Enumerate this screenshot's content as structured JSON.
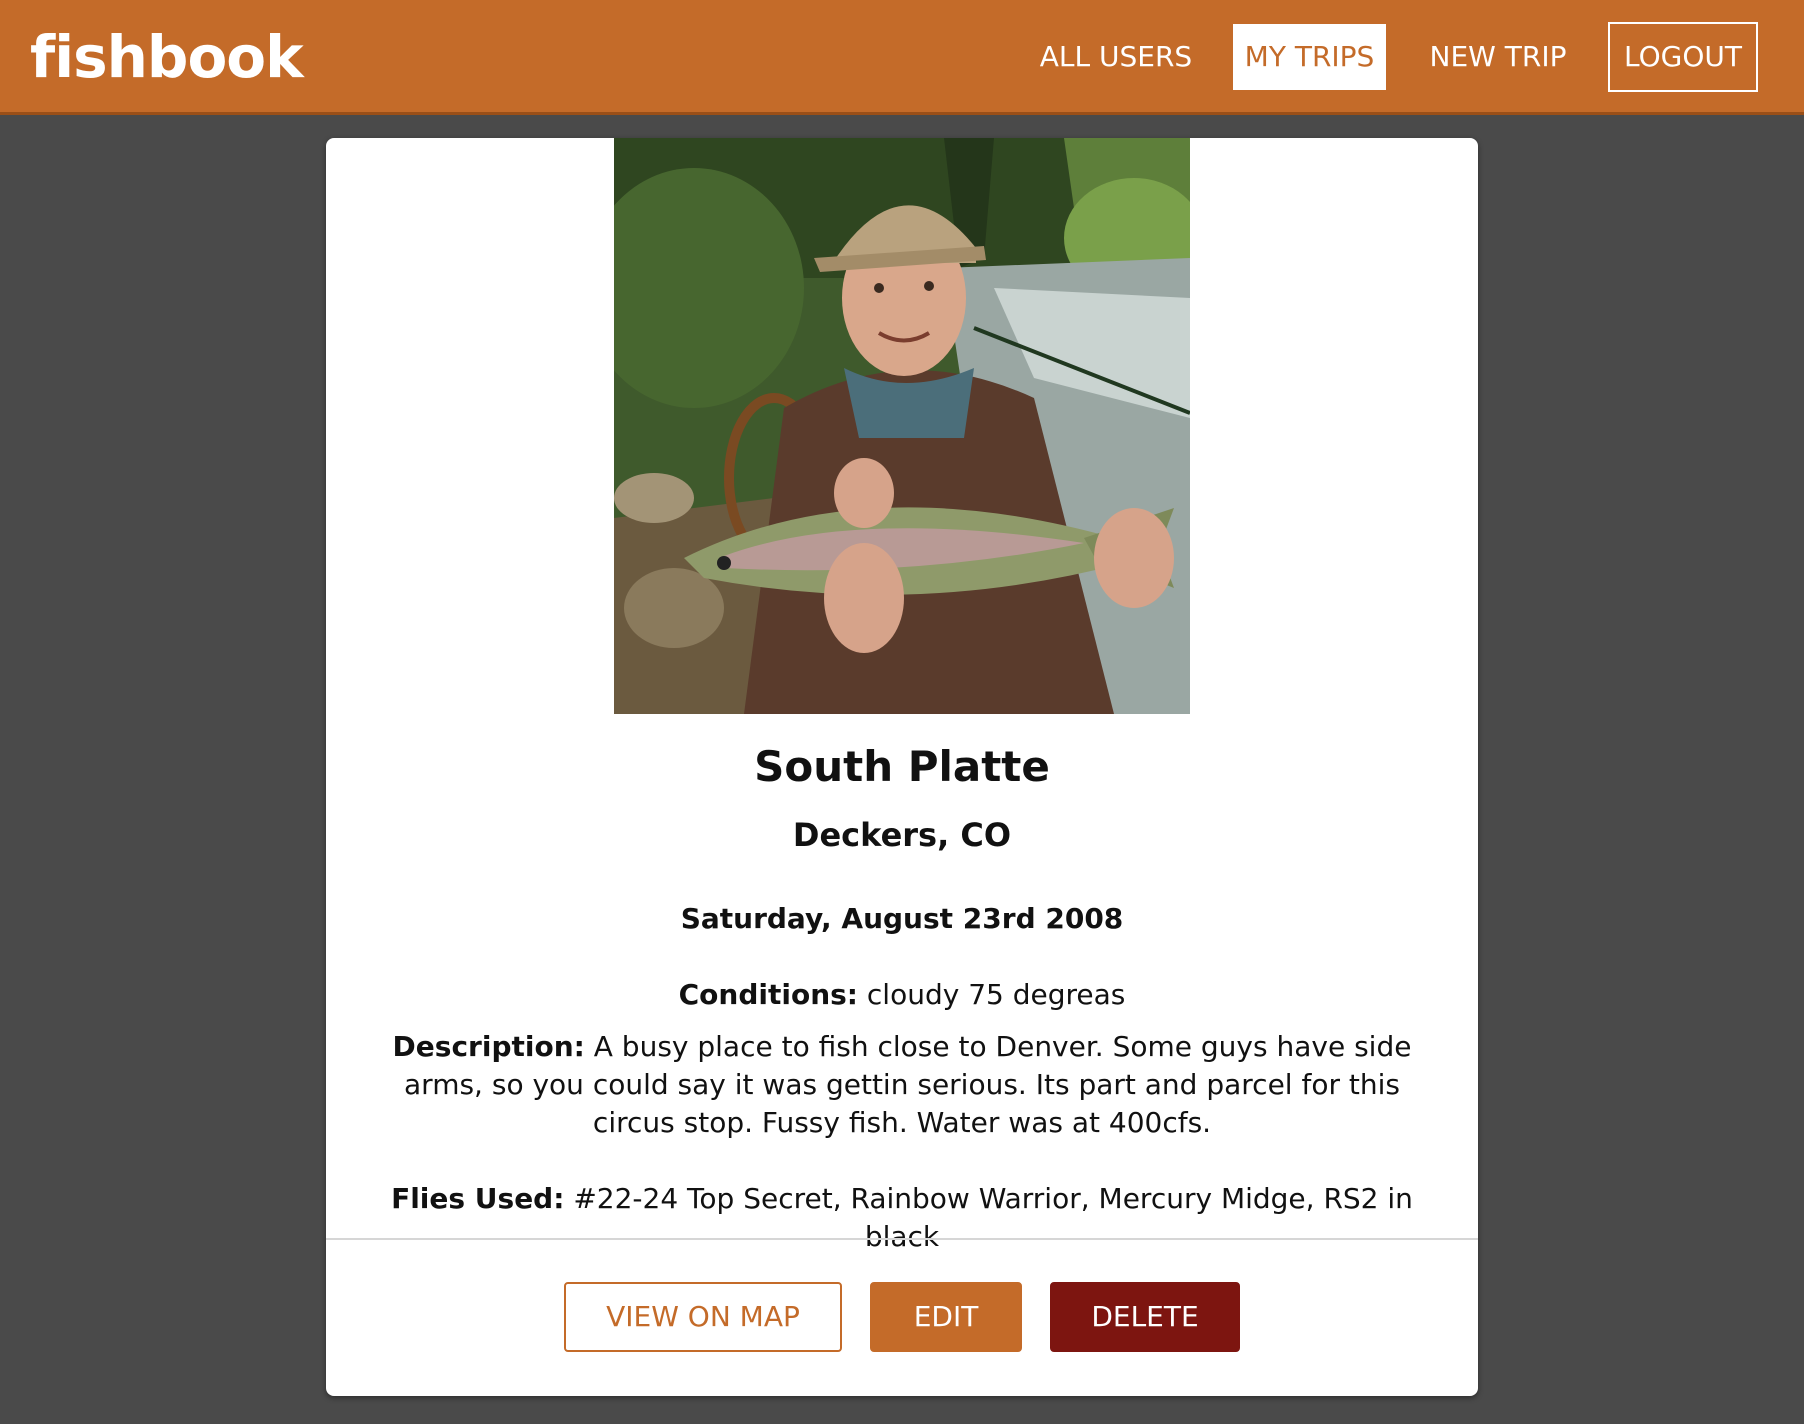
{
  "nav": {
    "brand": "fishbook",
    "items": [
      {
        "label": "ALL USERS"
      },
      {
        "label": "MY TRIPS"
      },
      {
        "label": "NEW TRIP"
      },
      {
        "label": "LOGOUT"
      }
    ],
    "active": "MY TRIPS"
  },
  "trip": {
    "photo_icon": "angler-with-trout-photo",
    "title": "South Platte",
    "location": "Deckers, CO",
    "date": "Saturday, August 23rd 2008",
    "conditions_label": "Conditions:",
    "conditions": "cloudy 75 degreas",
    "description_label": "Description:",
    "description": "A busy place to fish close to Denver. Some guys have side arms, so you could say it was gettin serious. Its part and parcel for this circus stop. Fussy fish. Water was at 400cfs.",
    "flies_label": "Flies Used:",
    "flies": "#22-24 Top Secret, Rainbow Warrior, Mercury Midge, RS2 in black"
  },
  "actions": {
    "view_on_map": "VIEW ON MAP",
    "edit": "EDIT",
    "delete": "DELETE"
  },
  "colors": {
    "brand": "#c46b29",
    "delete": "#7d1510",
    "background": "#4a4a4a"
  }
}
